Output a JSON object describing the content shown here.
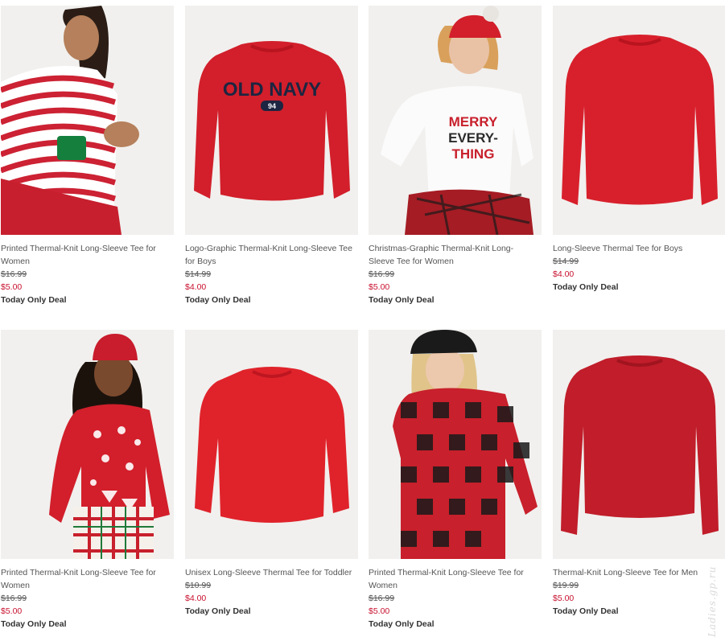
{
  "products": [
    {
      "title": "Printed Thermal-Knit Long-Sleeve Tee for Women",
      "was_price": "$16.99",
      "now_price": "$5.00",
      "deal": "Today Only Deal",
      "image": "woman-striped-red-white-tee"
    },
    {
      "title": "Logo-Graphic Thermal-Knit Long-Sleeve Tee for Boys",
      "was_price": "$14.99",
      "now_price": "$4.00",
      "deal": "Today Only Deal",
      "image": "red-old-navy-logo-tee",
      "graphic_text": "OLD NAVY",
      "graphic_number": "94"
    },
    {
      "title": "Christmas-Graphic Thermal-Knit Long-Sleeve Tee for Women",
      "was_price": "$16.99",
      "now_price": "$5.00",
      "deal": "Today Only Deal",
      "image": "woman-white-merry-everything-tee",
      "graphic_lines": [
        "MERRY",
        "EVERY-",
        "THING"
      ]
    },
    {
      "title": "Long-Sleeve Thermal Tee for Boys",
      "was_price": "$14.99",
      "now_price": "$4.00",
      "deal": "Today Only Deal",
      "image": "red-thermal-tee"
    },
    {
      "title": "Printed Thermal-Knit Long-Sleeve Tee for Women",
      "was_price": "$16.99",
      "now_price": "$5.00",
      "deal": "Today Only Deal",
      "image": "woman-red-fair-isle-tee"
    },
    {
      "title": "Unisex Long-Sleeve Thermal Tee for Toddler",
      "was_price": "$10.99",
      "now_price": "$4.00",
      "deal": "Today Only Deal",
      "image": "red-toddler-thermal-tee"
    },
    {
      "title": "Printed Thermal-Knit Long-Sleeve Tee for Women",
      "was_price": "$16.99",
      "now_price": "$5.00",
      "deal": "Today Only Deal",
      "image": "woman-buffalo-plaid-tee"
    },
    {
      "title": "Thermal-Knit Long-Sleeve Tee for Men",
      "was_price": "$19.99",
      "now_price": "$5.00",
      "deal": "Today Only Deal",
      "image": "red-men-thermal-tee"
    }
  ],
  "watermark": "Ladies.gp.ru",
  "colors": {
    "sale_red": "#c8102e",
    "shirt_red": "#d21f2b",
    "text": "#555555",
    "image_bg": "#efeeec"
  }
}
